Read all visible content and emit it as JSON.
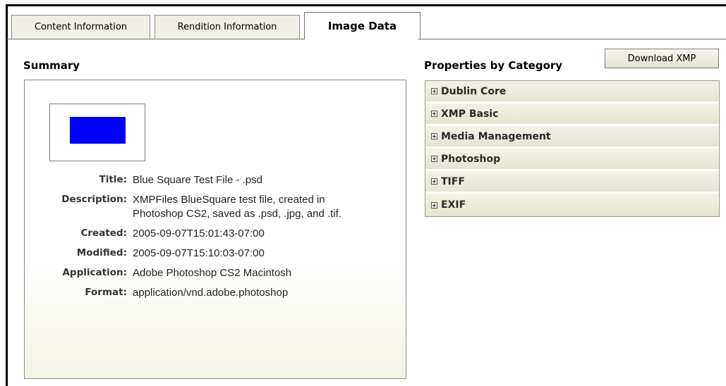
{
  "tabs": [
    {
      "label": "Content Information",
      "active": false
    },
    {
      "label": "Rendition Information",
      "active": false
    },
    {
      "label": "Image Data",
      "active": true
    }
  ],
  "summary": {
    "heading": "Summary",
    "thumbnail_color": "#0000ff",
    "properties": [
      {
        "label": "Title:",
        "value": "Blue Square Test File - .psd"
      },
      {
        "label": "Description:",
        "value": "XMPFiles BlueSquare test file, created in Photoshop CS2, saved as .psd, .jpg, and .tif."
      },
      {
        "label": "Created:",
        "value": "2005-09-07T15:01:43-07:00"
      },
      {
        "label": "Modified:",
        "value": "2005-09-07T15:10:03-07:00"
      },
      {
        "label": "Application:",
        "value": "Adobe Photoshop CS2 Macintosh"
      },
      {
        "label": "Format:",
        "value": "application/vnd.adobe.photoshop"
      }
    ]
  },
  "categories": {
    "heading": "Properties by Category",
    "download_label": "Download XMP",
    "items": [
      {
        "label": "Dublin Core",
        "icon": "expand-plus-icon"
      },
      {
        "label": "XMP Basic",
        "icon": "expand-plus-icon"
      },
      {
        "label": "Media Management",
        "icon": "expand-plus-icon"
      },
      {
        "label": "Photoshop",
        "icon": "expand-plus-icon"
      },
      {
        "label": "TIFF",
        "icon": "expand-plus-icon"
      },
      {
        "label": "EXIF",
        "icon": "expand-plus-icon"
      }
    ]
  }
}
